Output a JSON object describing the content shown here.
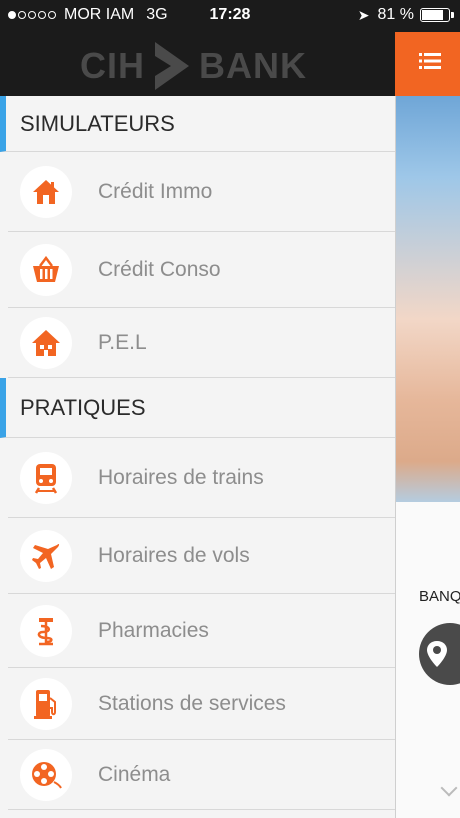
{
  "status_bar": {
    "carrier": "MOR IAM",
    "network": "3G",
    "time": "17:28",
    "battery_percent": "81 %",
    "battery_level": 0.81
  },
  "brand": {
    "logo_left": "CIH",
    "logo_right": "BANK"
  },
  "drawer": {
    "sections": [
      {
        "title": "SIMULATEURS",
        "items": [
          {
            "label": "Crédit Immo",
            "icon": "home-icon"
          },
          {
            "label": "Crédit Conso",
            "icon": "basket-icon"
          },
          {
            "label": "P.E.L",
            "icon": "house-icon"
          }
        ]
      },
      {
        "title": "PRATIQUES",
        "items": [
          {
            "label": "Horaires de trains",
            "icon": "train-icon"
          },
          {
            "label": "Horaires de vols",
            "icon": "plane-icon"
          },
          {
            "label": "Pharmacies",
            "icon": "pharmacy-icon"
          },
          {
            "label": "Stations de services",
            "icon": "fuel-icon"
          },
          {
            "label": "Cinéma",
            "icon": "film-reel-icon"
          }
        ]
      }
    ]
  },
  "main_peek": {
    "partial_text": "BANQ"
  },
  "colors": {
    "accent": "#f26522",
    "section_marker": "#3aa3e7",
    "header_bg": "#1b1b1b"
  }
}
